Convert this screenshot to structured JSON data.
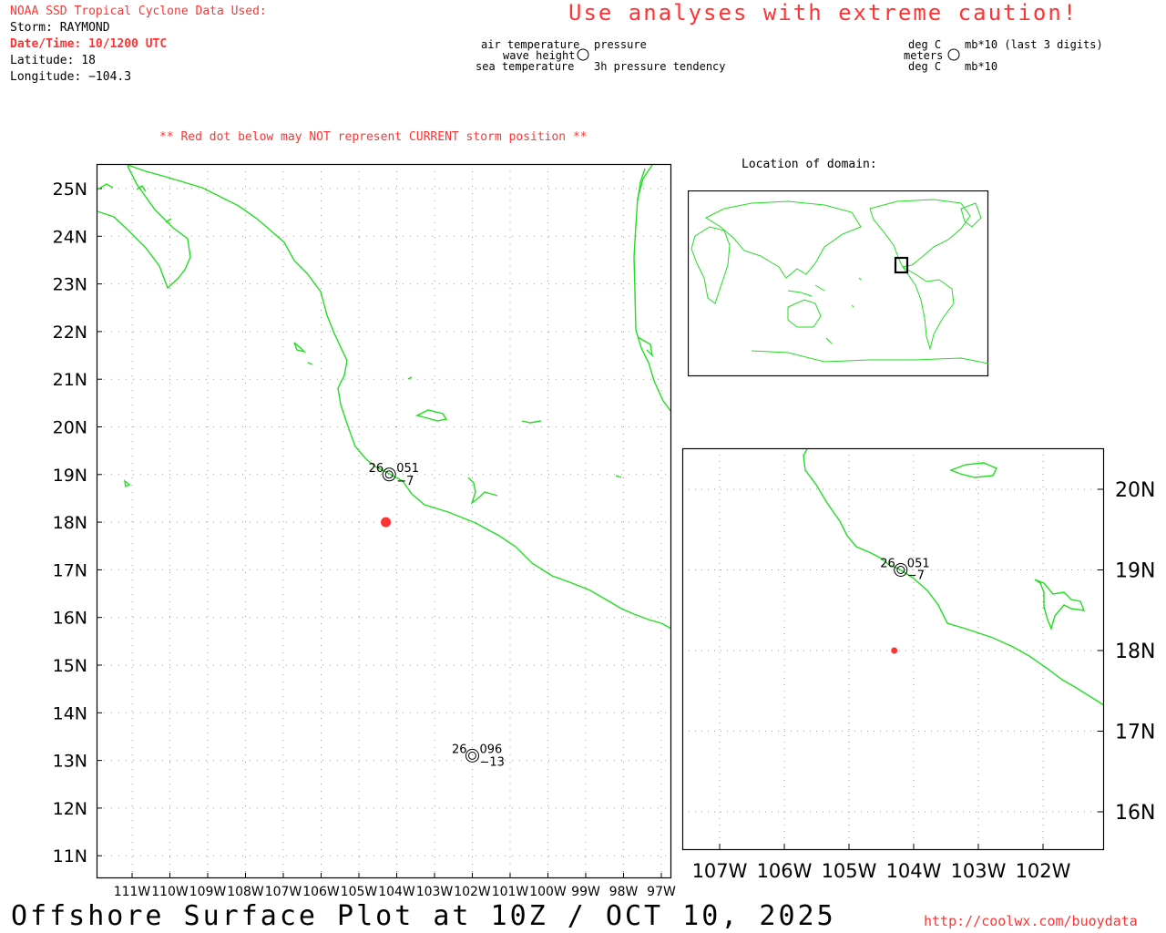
{
  "header": {
    "source_title": "NOAA SSD Tropical Cyclone Data Used:",
    "storm_line": "Storm: RAYMOND",
    "datetime_line": "Date/Time: 10/1200 UTC",
    "latitude_line": "Latitude: 18",
    "longitude_line": "Longitude: −104.3",
    "caution": "Use analyses with extreme caution!"
  },
  "legend_left": {
    "air_temperature": "air temperature",
    "wave_height": "wave height",
    "sea_temperature": "sea temperature",
    "pressure": "pressure",
    "pressure_tendency": "3h pressure tendency"
  },
  "legend_right": {
    "deg_c_top": "deg C",
    "meters": "meters",
    "deg_c_bottom": "deg C",
    "mb_last3": "mb*10 (last 3 digits)",
    "mb10": "mb*10"
  },
  "notice": "** Red dot below may NOT represent CURRENT storm position **",
  "location_label": "Location of domain:",
  "main_map": {
    "lat_labels": [
      "25N",
      "24N",
      "23N",
      "22N",
      "21N",
      "20N",
      "19N",
      "18N",
      "17N",
      "16N",
      "15N",
      "14N",
      "13N",
      "12N",
      "11N"
    ],
    "lon_labels": [
      "111W",
      "110W",
      "109W",
      "108W",
      "107W",
      "106W",
      "105W",
      "104W",
      "103W",
      "102W",
      "101W",
      "100W",
      "99W",
      "98W",
      "97W"
    ],
    "storm_position": {
      "lat": 18,
      "lon": -104.3
    },
    "stations": [
      {
        "lat": 19.0,
        "lon": -104.2,
        "air_temp": "26",
        "pressure": "051",
        "tendency": "−7"
      },
      {
        "lat": 13.1,
        "lon": -102.0,
        "air_temp": "26",
        "pressure": "096",
        "tendency": "−13"
      }
    ]
  },
  "inset_map": {
    "lat_labels": [
      "20N",
      "19N",
      "18N",
      "17N",
      "16N"
    ],
    "lon_labels": [
      "107W",
      "106W",
      "105W",
      "104W",
      "103W",
      "102W"
    ],
    "station": {
      "air_temp": "26",
      "pressure": "051",
      "tendency": "−7"
    }
  },
  "colors": {
    "coast": "#22dd22",
    "storm": "#ff3333",
    "text_red": "#ff3333",
    "grid": "#999999"
  },
  "footer": {
    "title": "Offshore Surface Plot at 10Z / OCT 10, 2025",
    "url": "http://coolwx.com/buoydata"
  }
}
